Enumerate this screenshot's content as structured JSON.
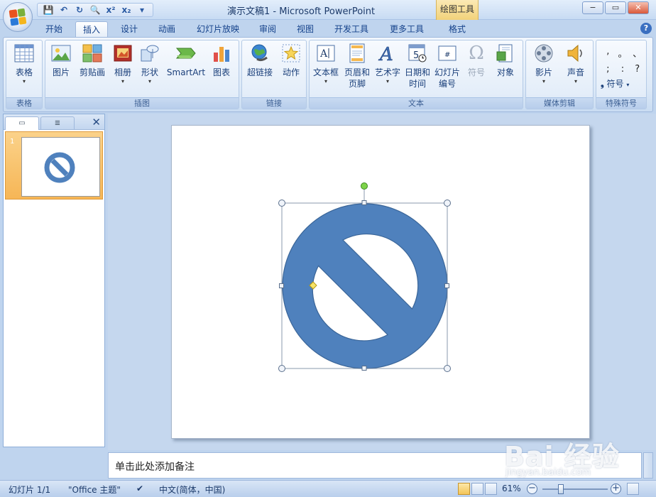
{
  "title_bar": {
    "title": "演示文稿1 - Microsoft PowerPoint",
    "contextual_tab": "绘图工具",
    "qat_icons": [
      "save-icon",
      "undo-icon",
      "redo-icon",
      "print-preview-icon",
      "superscript-icon",
      "subscript-icon",
      "customize-qat-icon"
    ],
    "qat_glyphs": [
      "💾",
      "↶",
      "↻",
      "🔍",
      "x²",
      "x₂",
      "▾"
    ],
    "window_controls": {
      "minimize": "−",
      "restore": "▭",
      "close": "✕"
    }
  },
  "tabs": [
    "开始",
    "插入",
    "设计",
    "动画",
    "幻灯片放映",
    "审阅",
    "视图",
    "开发工具",
    "更多工具",
    "格式"
  ],
  "active_tab": "插入",
  "help": "?",
  "ribbon": {
    "groups": {
      "table": {
        "label": "表格",
        "buttons": {
          "table": "表格"
        }
      },
      "illustrations": {
        "label": "插图",
        "buttons": {
          "picture": "图片",
          "clipart": "剪贴画",
          "album": "相册",
          "shapes": "形状",
          "smartart": "SmartArt",
          "chart": "图表"
        }
      },
      "links": {
        "label": "链接",
        "buttons": {
          "hyperlink": "超链接",
          "action": "动作"
        }
      },
      "text": {
        "label": "文本",
        "buttons": {
          "textbox": "文本框",
          "header_footer_1": "页眉和",
          "header_footer_2": "页脚",
          "wordart": "艺术字",
          "datetime_1": "日期和",
          "datetime_2": "时间",
          "slidenum_1": "幻灯片",
          "slidenum_2": "编号",
          "symbol": "符号",
          "object": "对象"
        }
      },
      "media": {
        "label": "媒体剪辑",
        "buttons": {
          "movie": "影片",
          "sound": "声音"
        }
      },
      "special": {
        "label": "特殊符号",
        "buttons": {
          "symbol": "符号"
        },
        "marks": [
          ",",
          "。",
          "、",
          ";",
          ":",
          "?"
        ]
      }
    }
  },
  "slides_panel": {
    "slide_number": "1"
  },
  "notes": {
    "placeholder": "单击此处添加备注"
  },
  "status": {
    "slide_info": "幻灯片 1/1",
    "theme": "\"Office 主题\"",
    "language": "中文(简体，中国)",
    "zoom": "61%",
    "zoom_fraction": 0.61
  },
  "watermark": {
    "brand": "Bai 经验",
    "url": "jingyan.baidu.com"
  },
  "colors": {
    "shape_fill": "#4f81bd",
    "shape_stroke": "#3a6598",
    "accent": "#15428b"
  }
}
